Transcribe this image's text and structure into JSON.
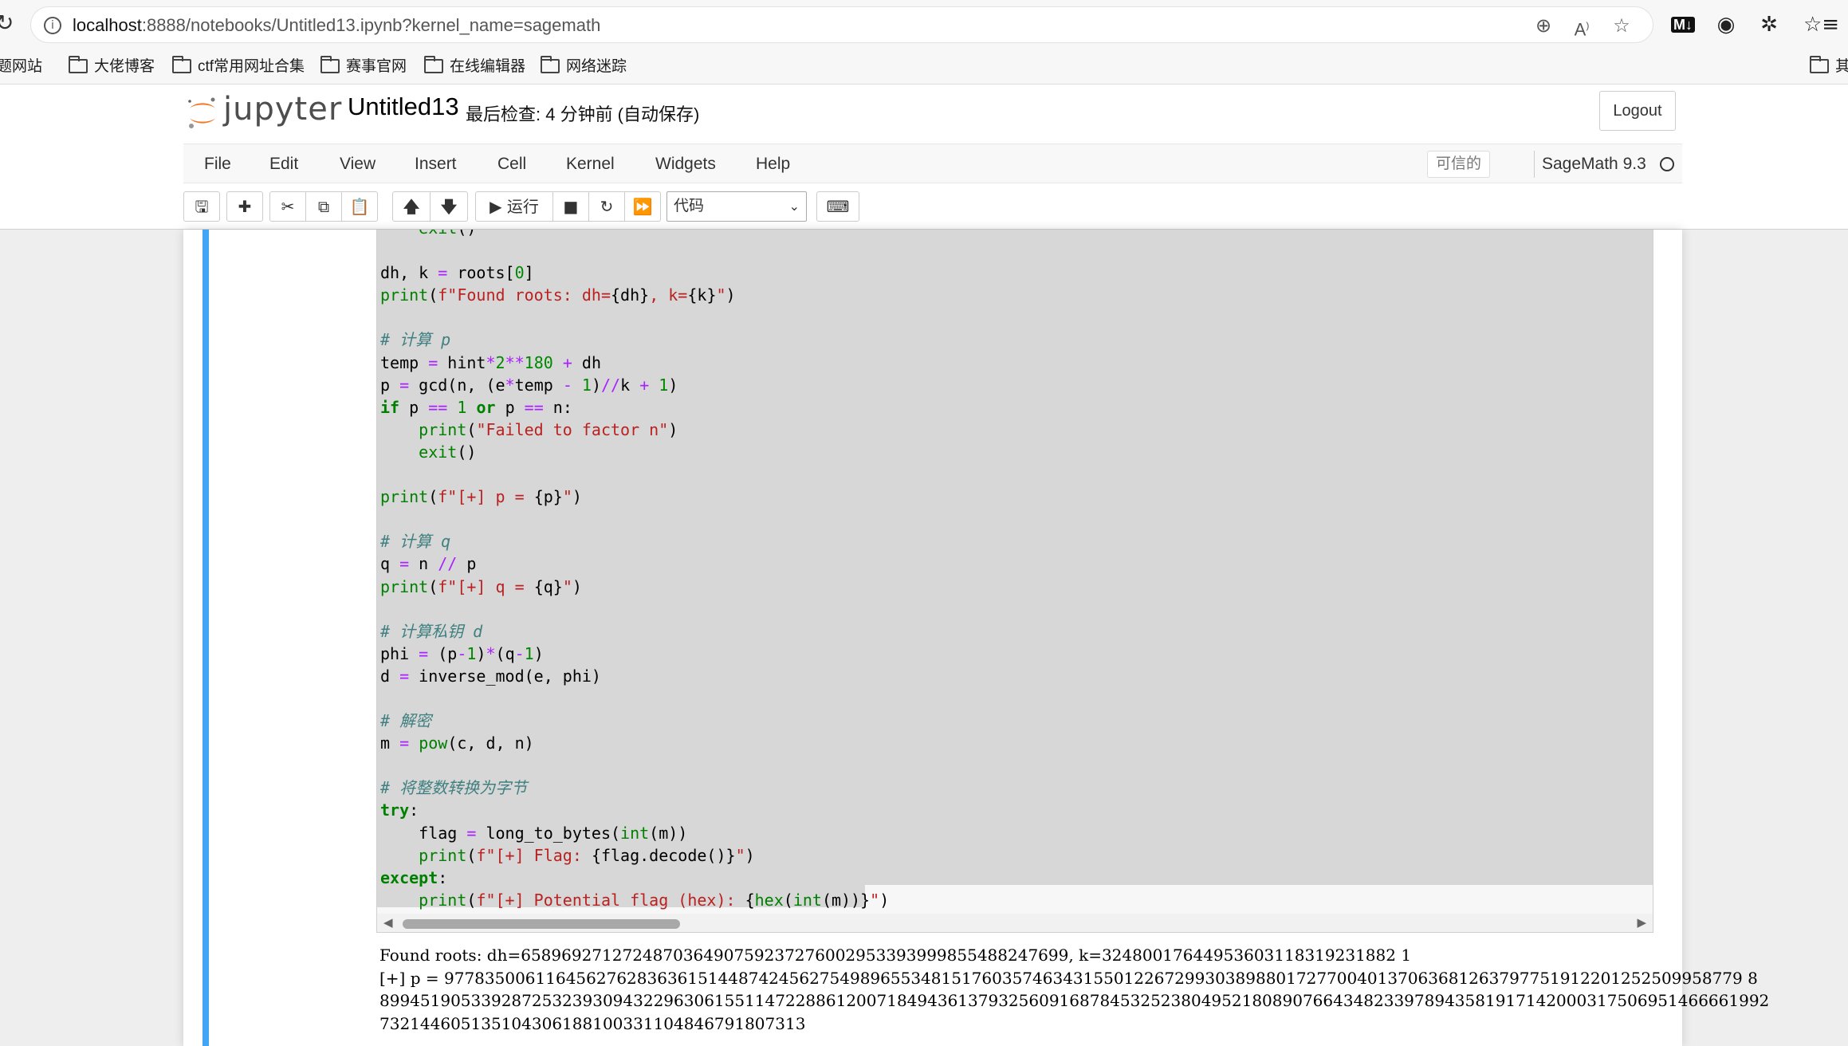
{
  "browser": {
    "url_host": "localhost",
    "url_path": ":8888/notebooks/Untitled13.ipynb?kernel_name=sagemath",
    "bookmarks": [
      "题网站",
      "大佬博客",
      "ctf常用网址合集",
      "赛事官网",
      "在线编辑器",
      "网络迷踪",
      "其"
    ]
  },
  "header": {
    "logo_text": "jupyter",
    "notebook_title": "Untitled13",
    "checkpoint": "最后检查: 4 分钟前  (自动保存)",
    "logout": "Logout"
  },
  "menu": {
    "items": [
      "File",
      "Edit",
      "View",
      "Insert",
      "Cell",
      "Kernel",
      "Widgets",
      "Help"
    ],
    "trusted": "可信的",
    "kernel": "SageMath 9.3"
  },
  "toolbar": {
    "run_label": "运行",
    "cell_type": "代码"
  },
  "code": {
    "lines": [
      "    exit()",
      "",
      "dh, k = roots[0]",
      "print(f\"Found roots: dh={dh}, k={k}\")",
      "",
      "# 计算 p",
      "temp = hint*2**180 + dh",
      "p = gcd(n, (e*temp - 1)//k + 1)",
      "if p == 1 or p == n:",
      "    print(\"Failed to factor n\")",
      "    exit()",
      "",
      "print(f\"[+] p = {p}\")",
      "",
      "# 计算 q",
      "q = n // p",
      "print(f\"[+] q = {q}\")",
      "",
      "# 计算私钥 d",
      "phi = (p-1)*(q-1)",
      "d = inverse_mod(e, phi)",
      "",
      "# 解密",
      "m = pow(c, d, n)",
      "",
      "# 将整数转换为字节",
      "try:",
      "    flag = long_to_bytes(int(m))",
      "    print(f\"[+] Flag: {flag.decode()}\")",
      "except:",
      "    print(f\"[+] Potential flag (hex): {hex(int(m))}\")"
    ]
  },
  "output": {
    "lines": [
      "Found roots: dh=658969271272487036490759237276002953393999855488247699, k=32480017644953603118319231882 1",
      "[+] p = 97783500611645627628363615144874245627549896553481517603574634315501226729930389880172770040137063681263797751912201252509958779 8",
      "89945190533928725323930943229630615511472288612007184943613793256091687845325238049521808907664348233978943581917142000317506951466661992",
      "732144605135104306188100331104846791807313"
    ]
  }
}
